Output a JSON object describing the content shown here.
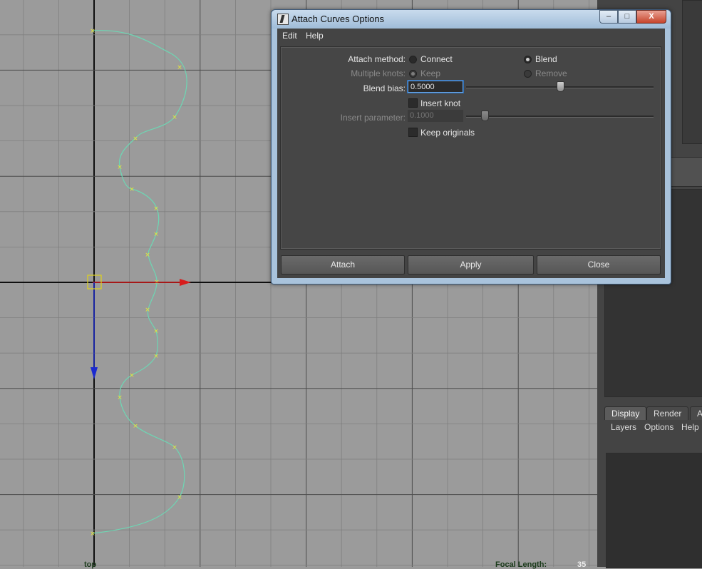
{
  "viewport": {
    "camera_label": "top",
    "focal_length_label": "Focal Length:",
    "focal_length_value": "35"
  },
  "dialog": {
    "title": "Attach Curves Options",
    "window_buttons": {
      "minimize": "–",
      "maximize": "□",
      "close": "X"
    },
    "menus": [
      "Edit",
      "Help"
    ],
    "attach_method": {
      "label": "Attach method:",
      "options": [
        "Connect",
        "Blend"
      ],
      "selected": "Blend"
    },
    "multiple_knots": {
      "label": "Multiple knots:",
      "options": [
        "Keep",
        "Remove"
      ],
      "selected": "Keep",
      "enabled": false
    },
    "blend_bias": {
      "label": "Blend bias:",
      "value": "0.5000",
      "slider_fraction": 0.5
    },
    "insert_knot": {
      "label": "Insert knot",
      "checked": false
    },
    "insert_parameter": {
      "label": "Insert parameter:",
      "value": "0.1000",
      "slider_fraction": 0.1,
      "enabled": false
    },
    "keep_originals": {
      "label": "Keep originals",
      "checked": false
    },
    "buttons": {
      "attach": "Attach",
      "apply": "Apply",
      "close": "Close"
    }
  },
  "layer_editor": {
    "tabs": [
      "Display",
      "Render",
      "An"
    ],
    "active_tab": "Display",
    "menus": [
      "Layers",
      "Options",
      "Help"
    ]
  },
  "colors": {
    "viewport_bg": "#9b9b9b",
    "grid_line": "#7f7f7f",
    "axis_line": "#0f0f0f",
    "curve": "#6dd7b4",
    "cv_marker": "#e6e63a",
    "x_axis_manip": "#d81c1c",
    "y_axis_manip": "#1b2ad0",
    "pivot": "#e0d21a"
  }
}
